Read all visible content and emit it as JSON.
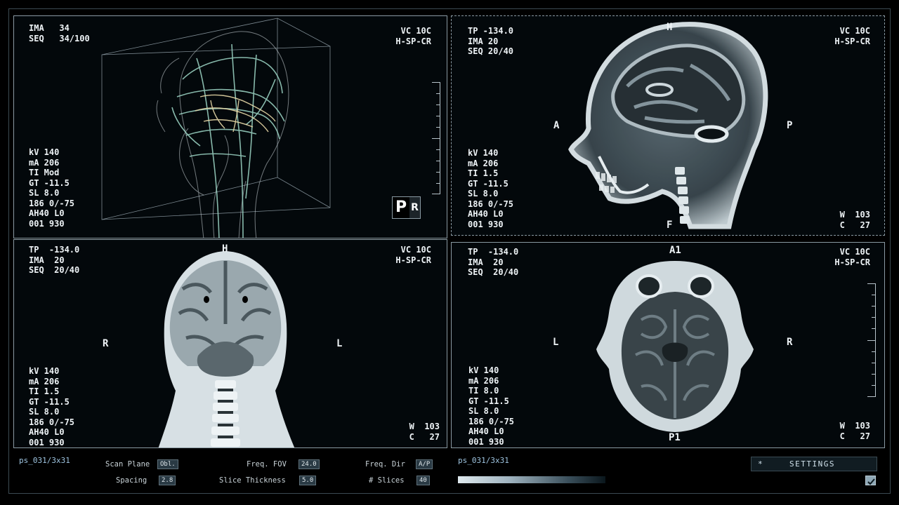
{
  "panels": {
    "top_left": {
      "header_left": "IMA   34\nSEQ   34/100",
      "header_right": "VC 10C\nH-SP-CR",
      "params": "kV 140\nmA 206\nTI Mod\nGT -11.5\nSL 8.0\n186 0/-75\nAH40 L0\n001 930",
      "badge_left": "P",
      "badge_right": "R"
    },
    "top_right": {
      "header_left": "TP -134.0\nIMA 20\nSEQ 20/40",
      "header_right": "VC 10C\nH-SP-CR",
      "params": "kV 140\nmA 206\nTI 1.5\nGT -11.5\nSL 8.0\n186 0/-75\nAH40 L0\n001 930",
      "wc": "W  103\nC   27",
      "orient_top": "H",
      "orient_left": "A",
      "orient_right": "P",
      "orient_bottom": "F"
    },
    "bottom_left": {
      "header_left": "TP  -134.0\nIMA  20\nSEQ  20/40",
      "header_right": "VC 10C\nH-SP-CR",
      "params": "kV 140\nmA 206\nTI 1.5\nGT -11.5\nSL 8.0\n186 0/-75\nAH40 L0\n001 930",
      "wc": "W  103\nC   27",
      "orient_top": "H",
      "orient_left": "R",
      "orient_right": "L"
    },
    "bottom_right": {
      "header_left": "TP  -134.0\nIMA  20\nSEQ  20/40",
      "header_right": "VC 10C\nH-SP-CR",
      "params": "kV 140\nmA 206\nTI 8.0\nGT -11.5\nSL 8.0\n186 0/-75\nAH40 L0\n001 930",
      "wc": "W  103\nC   27",
      "orient_top": "A1",
      "orient_left": "L",
      "orient_right": "R",
      "orient_bottom": "P1"
    }
  },
  "controls": {
    "left_id": "ps_031/3x31",
    "right_id": "ps_031/3x31",
    "scan_plane_label": "Scan Plane",
    "scan_plane_value": "Obl.",
    "freq_fov_label": "Freq. FOV",
    "freq_fov_value": "24.0",
    "freq_dir_label": "Freq. Dir",
    "freq_dir_value": "A/P",
    "spacing_label": "Spacing",
    "spacing_value": "2.8",
    "slice_thickness_label": "Slice Thickness",
    "slice_thickness_value": "5.0",
    "slices_label": "# Slices",
    "slices_value": "40",
    "settings_star": "*",
    "settings_label": "SETTINGS",
    "checkbox_checked": true
  },
  "colors": {
    "background": "#000000",
    "panel": "#03080b",
    "border": "#8a9aa3",
    "text": "#eef3f6",
    "accent_id": "#9ec4e0",
    "vessels": "#9fd8c8",
    "vessels_core": "#e8d9a8"
  }
}
